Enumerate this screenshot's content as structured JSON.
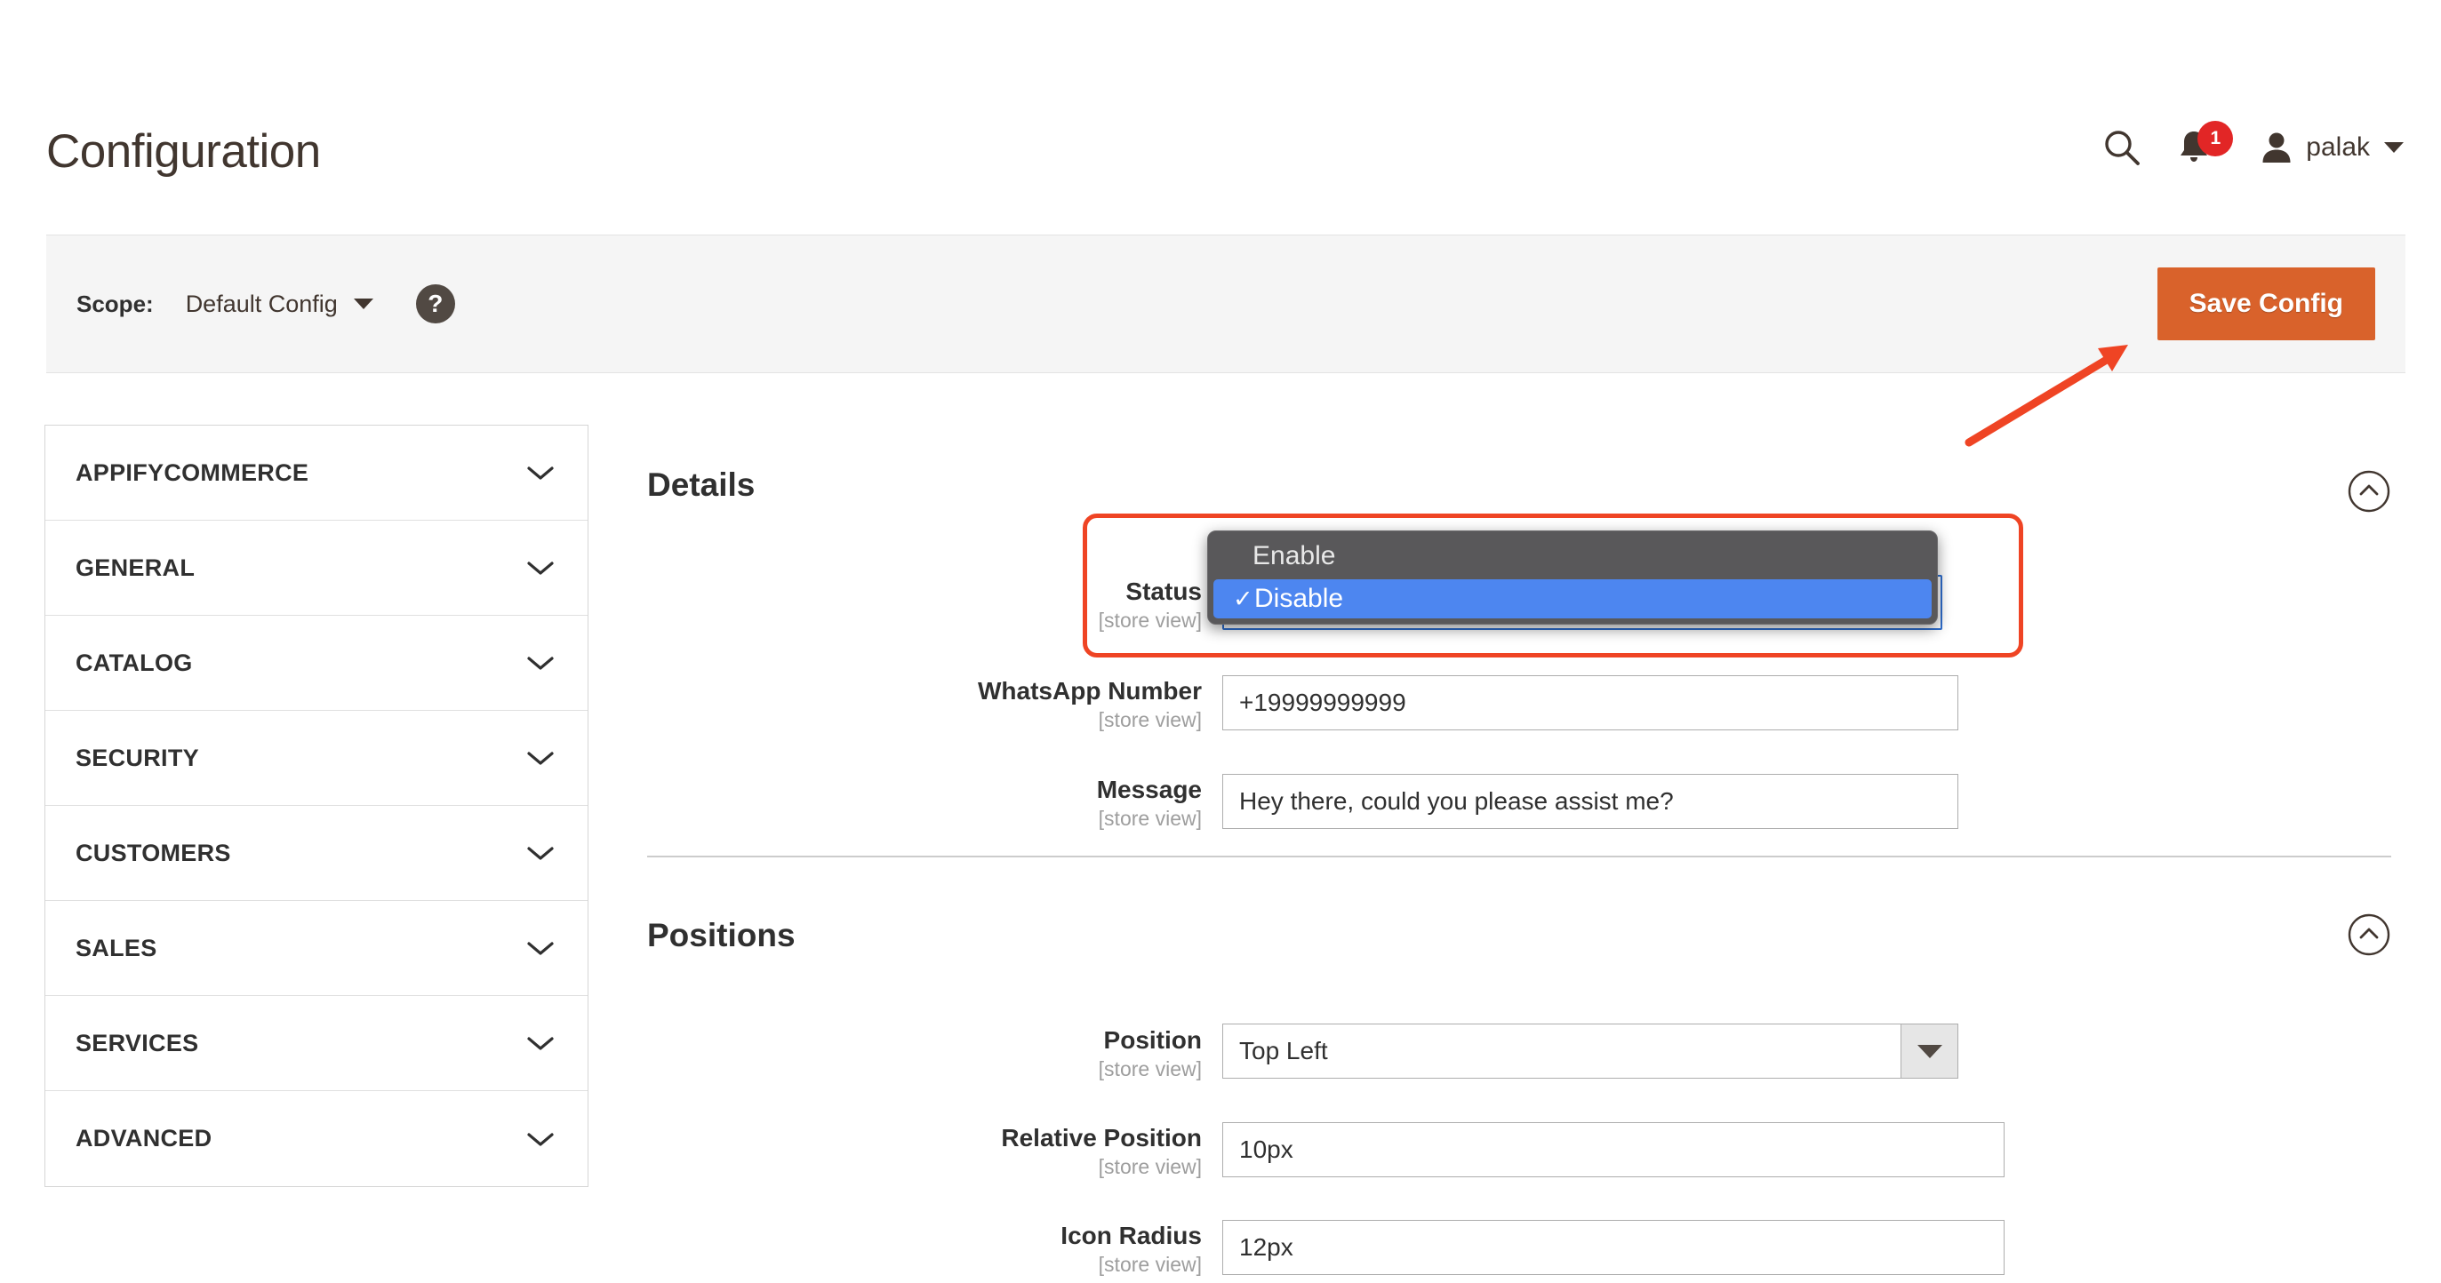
{
  "header": {
    "page_title": "Configuration",
    "search_icon": "search-icon",
    "notifications_icon": "bell-icon",
    "notifications_count": "1",
    "user_avatar_icon": "user-avatar-icon",
    "user_name": "palak",
    "user_caret_icon": "chevron-down-icon"
  },
  "scope_bar": {
    "label": "Scope:",
    "value": "Default Config",
    "caret_icon": "chevron-down-icon",
    "help_icon": "question-mark-icon",
    "help_label": "?",
    "save_label": "Save Config",
    "save_color": "#d9622b"
  },
  "sidebar": {
    "items": [
      {
        "label": "APPIFYCOMMERCE",
        "icon": "chevron-down-icon"
      },
      {
        "label": "GENERAL",
        "icon": "chevron-down-icon"
      },
      {
        "label": "CATALOG",
        "icon": "chevron-down-icon"
      },
      {
        "label": "SECURITY",
        "icon": "chevron-down-icon"
      },
      {
        "label": "CUSTOMERS",
        "icon": "chevron-down-icon"
      },
      {
        "label": "SALES",
        "icon": "chevron-down-icon"
      },
      {
        "label": "SERVICES",
        "icon": "chevron-down-icon"
      },
      {
        "label": "ADVANCED",
        "icon": "chevron-down-icon"
      }
    ]
  },
  "sections": {
    "details": {
      "title": "Details",
      "toggle_icon": "chevron-up-circle-icon",
      "fields": {
        "status": {
          "label": "Status",
          "scope": "[store view]",
          "options": [
            {
              "label": "Enable",
              "selected": false
            },
            {
              "label": "Disable",
              "selected": true
            }
          ],
          "checkmark": "✓",
          "selected_value": "Disable",
          "highlight_color": "#ef4424"
        },
        "whatsapp_number": {
          "label": "WhatsApp Number",
          "scope": "[store view]",
          "value": "+19999999999"
        },
        "message": {
          "label": "Message",
          "scope": "[store view]",
          "value": "Hey there, could you please assist me?"
        }
      }
    },
    "positions": {
      "title": "Positions",
      "toggle_icon": "chevron-up-circle-icon",
      "fields": {
        "position": {
          "label": "Position",
          "scope": "[store view]",
          "value": "Top Left",
          "arrow_icon": "triangle-down-icon"
        },
        "relative_position": {
          "label": "Relative Position",
          "scope": "[store view]",
          "value": "10px"
        },
        "icon_radius": {
          "label": "Icon Radius",
          "scope": "[store view]",
          "value": "12px"
        }
      }
    }
  },
  "annotations": {
    "arrow": {
      "name": "save-config-pointer-arrow",
      "color": "#ef4424"
    },
    "highlight": {
      "name": "status-field-highlight",
      "color": "#ef4424"
    }
  }
}
